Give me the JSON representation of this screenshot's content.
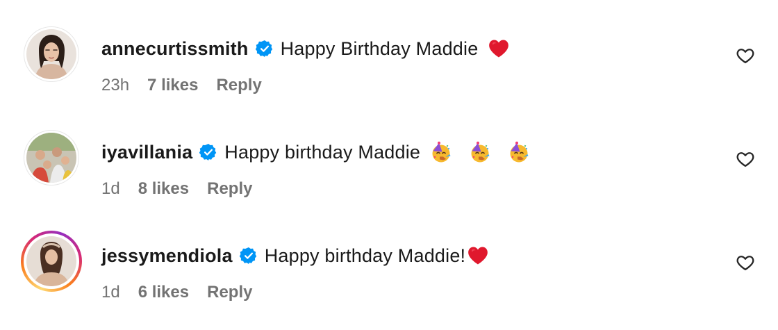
{
  "comments": [
    {
      "username": "annecurtissmith",
      "text": "Happy Birthday Maddie",
      "emojis": [
        "red-heart"
      ],
      "time": "23h",
      "likes": "7 likes",
      "reply_label": "Reply",
      "story_ring": false
    },
    {
      "username": "iyavillania",
      "text": "Happy birthday Maddie",
      "emojis": [
        "partying-face",
        "partying-face",
        "partying-face"
      ],
      "time": "1d",
      "likes": "8 likes",
      "reply_label": "Reply",
      "story_ring": false
    },
    {
      "username": "jessymendiola",
      "text": "Happy birthday Maddie!",
      "emojis": [
        "red-heart"
      ],
      "time": "1d",
      "likes": "6 likes",
      "reply_label": "Reply",
      "story_ring": true
    }
  ],
  "colors": {
    "verified": "#0095f6",
    "meta_text": "#737373",
    "heart_emoji": "#e0182d",
    "story_ring": [
      "#feda75",
      "#fa7e1e",
      "#d62976",
      "#962fbf"
    ]
  },
  "icons": {
    "verified": "verified-badge-icon",
    "like": "heart-outline-icon"
  }
}
